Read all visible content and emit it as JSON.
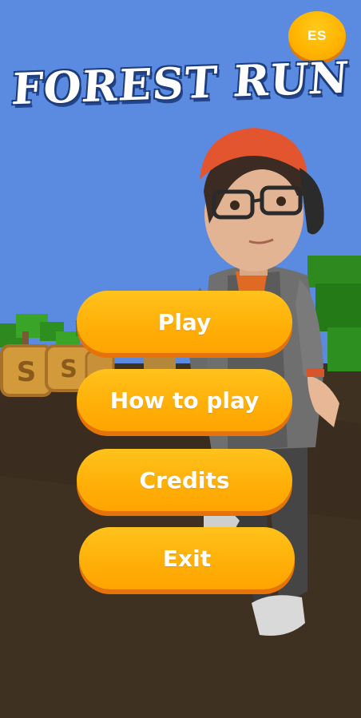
{
  "app": {
    "title": "FOREST RUN"
  },
  "language_button": {
    "label": "ES"
  },
  "menu": {
    "items": [
      {
        "id": "play",
        "label": "Play"
      },
      {
        "id": "how_to_play",
        "label": "How to play"
      },
      {
        "id": "credits",
        "label": "Credits"
      },
      {
        "id": "exit",
        "label": "Exit"
      }
    ]
  },
  "coins": {
    "glyph": "S",
    "count_visible": 4
  },
  "colors": {
    "sky": "#5b8be0",
    "ground": "#3f3121",
    "button": "#ffb008",
    "button_shadow": "#e6720a",
    "title_outline": "#1d3c7a",
    "cap": "#e2552f",
    "jacket": "#6e6e6e"
  },
  "icons": {
    "coin": "coin-icon",
    "character": "player-character"
  }
}
